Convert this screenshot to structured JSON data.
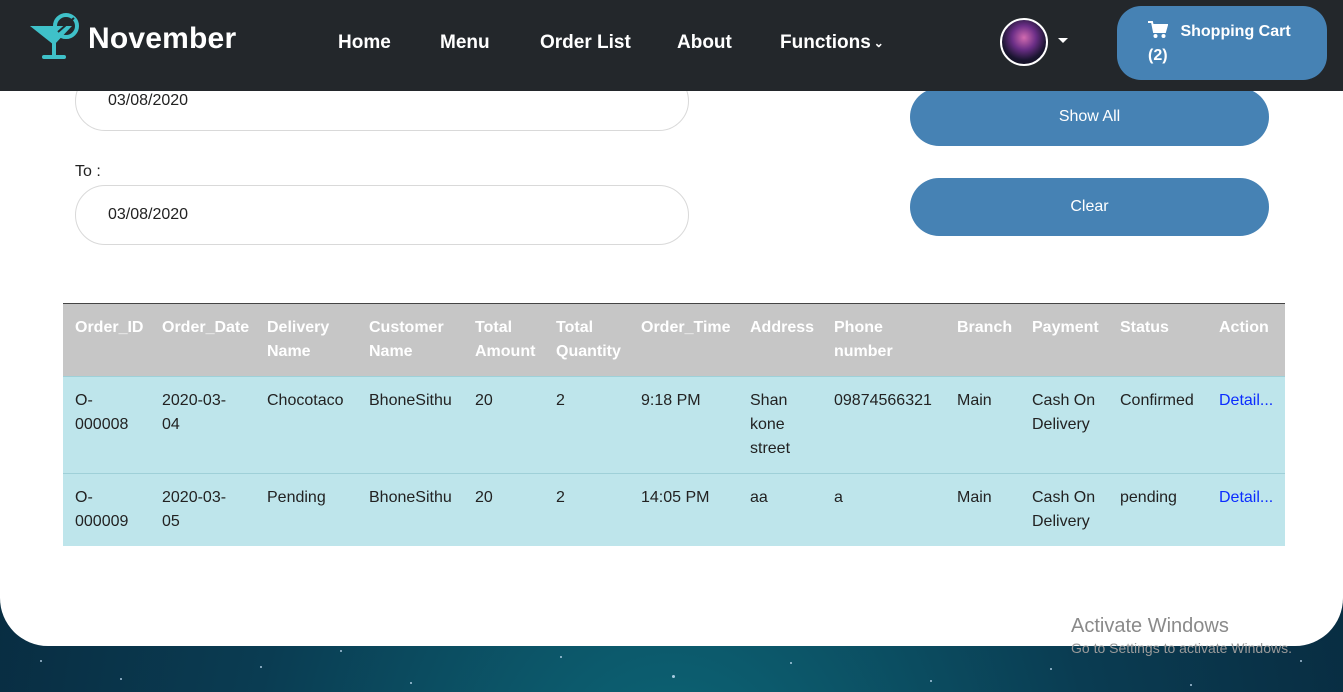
{
  "navbar": {
    "brand": "November",
    "links": [
      "Home",
      "Menu",
      "Order List",
      "About",
      "Functions"
    ],
    "cart_label": "Shopping Cart",
    "cart_count": "(2)"
  },
  "filter": {
    "from_date": "03/08/2020",
    "to_label": "To :",
    "to_date": "03/08/2020",
    "show_all_label": "Show All",
    "clear_label": "Clear"
  },
  "table": {
    "headers": [
      "Order_ID",
      "Order_Date",
      "Delivery Name",
      "Customer Name",
      "Total Amount",
      "Total Quantity",
      "Order_Time",
      "Address",
      "Phone number",
      "Branch",
      "Payment",
      "Status",
      "Action"
    ],
    "rows": [
      [
        "O-000008",
        "2020-03-04",
        "Chocotaco",
        "BhoneSithu",
        "20",
        "2",
        "9:18 PM",
        "Shan kone street",
        "09874566321",
        "Main",
        "Cash On Delivery",
        "Confirmed",
        "Detail..."
      ],
      [
        "O-000009",
        "2020-03-05",
        "Pending",
        "BhoneSithu",
        "20",
        "2",
        "14:05 PM",
        "aa",
        "a",
        "Main",
        "Cash On Delivery",
        "pending",
        "Detail..."
      ]
    ]
  },
  "watermark": {
    "line1": "Activate Windows",
    "line2": "Go to Settings to activate Windows."
  },
  "colors": {
    "navbar_bg": "#23272b",
    "accent_blue": "#4682b4",
    "brand_teal": "#3fc1c9",
    "table_header": "#c6c6c6",
    "table_row": "#bee5eb",
    "link": "#0b2cff"
  },
  "icons": {
    "brand": "cocktail-glass-icon",
    "cart": "shopping-cart-icon",
    "dropdown": "chevron-down-icon"
  }
}
